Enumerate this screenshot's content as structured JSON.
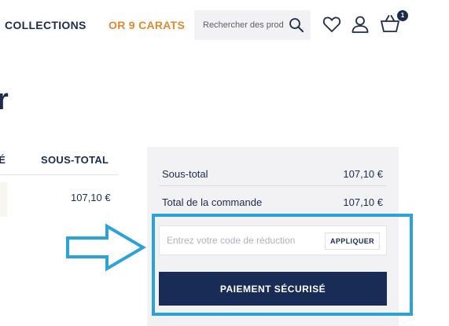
{
  "header": {
    "nav": {
      "collections": "COLLECTIONS",
      "or9": "OR 9 CARATS"
    },
    "search": {
      "placeholder": "Rechercher des prod"
    },
    "cart_count": "1",
    "icons": {
      "search": "search-icon",
      "wishlist": "heart-icon",
      "account": "user-icon",
      "cart": "basket-icon"
    }
  },
  "page": {
    "title_fragment": "r"
  },
  "cart_table": {
    "headers": {
      "qty": "TÉ",
      "subtotal": "SOUS-TOTAL"
    },
    "row": {
      "subtotal": "107,10 €"
    }
  },
  "summary": {
    "subtotal_label": "Sous-total",
    "subtotal_value": "107,10 €",
    "total_label": "Total de la commande",
    "total_value": "107,10 €",
    "coupon_placeholder": "Entrez votre code de réduction",
    "apply_label": "APPLIQUER",
    "pay_label": "PAIEMENT SÉCURISÉ"
  },
  "colors": {
    "navy": "#1d2b4f",
    "accent_orange": "#e0892f",
    "pay_button": "#192c56",
    "annotation_blue": "#2ba3d6",
    "panel_bg": "#f2f2f4"
  }
}
